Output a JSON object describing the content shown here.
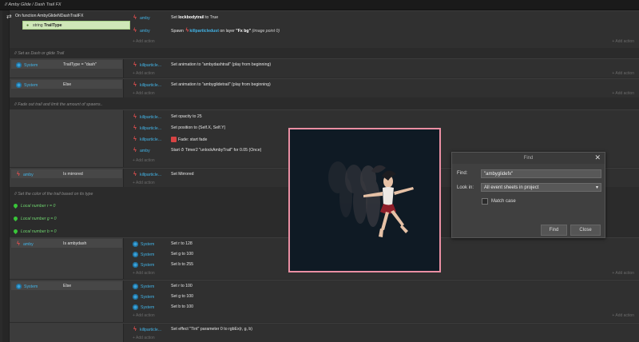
{
  "breadcrumb": "//  Amby Glide / Dash Trail FX",
  "function_block": {
    "header": "On function AmbyGlideNDashTrailFX",
    "param_type": "string",
    "param_name": "TrailType",
    "actions": [
      {
        "object": "amby",
        "text_pre": "Set ",
        "bold": "lockbodytrail",
        "text_post": " to True"
      },
      {
        "object": "amby",
        "text_pre": "Spawn ",
        "bold": "killparticledust",
        "text_post": " on layer ",
        "bold2": "\"Fx bg\"",
        "text_post2": " (image point 0)"
      }
    ]
  },
  "add_action": "+ Add action",
  "comments": [
    "//  Set as Dash or glide Trail",
    "//  Fade out trail and limit the amount of spawns..",
    "//  Set the color of the trail based on its type"
  ],
  "events": [
    {
      "cond_obj": "System",
      "cond_text": "TrailType = \"dash\"",
      "action": {
        "object": "killparticle...",
        "text": "Set animation to \"ambydashtrail\" (play from beginning)"
      }
    },
    {
      "cond_obj": "System",
      "cond_text": "Else",
      "action": {
        "object": "killparticle...",
        "text": "Set animation to \"ambyglidetrail\" (play from beginning)"
      }
    }
  ],
  "fade_actions": [
    {
      "object": "killparticle...",
      "text": "Set opacity to 25"
    },
    {
      "object": "killparticle...",
      "text": "Set position to (Self.X, Self.Y)"
    },
    {
      "object": "killparticle...",
      "text": "Fade: start fade"
    },
    {
      "object": "amby",
      "text": "Start ⏱ Timer2 \"unlockAmbyTrail\" for 0.05 (Once)"
    }
  ],
  "mirrored_event": {
    "cond_obj": "amby",
    "cond_text": "Is mirrored",
    "action": {
      "object": "killparticle...",
      "text": "Set Mirrored"
    }
  },
  "local_vars": [
    "Local number r = 0",
    "Local number g = 0",
    "Local number b = 0"
  ],
  "dash_event": {
    "cond_obj": "amby",
    "cond_text": "Is ambydash",
    "actions": [
      {
        "object": "System",
        "text": "Set r to 128"
      },
      {
        "object": "System",
        "text": "Set g to 100"
      },
      {
        "object": "System",
        "text": "Set b to 255"
      }
    ]
  },
  "else_event": {
    "cond_obj": "System",
    "cond_text": "Else",
    "actions": [
      {
        "object": "System",
        "text": "Set r to 100"
      },
      {
        "object": "System",
        "text": "Set g to 100"
      },
      {
        "object": "System",
        "text": "Set b to 100"
      }
    ]
  },
  "effect_action": {
    "object": "killparticle...",
    "text": "Set effect \"Tint\" parameter 0 to rgbEx(r, g, b)"
  },
  "find_dialog": {
    "title": "Find",
    "find_label": "Find:",
    "find_value": "\"ambyglidefx\"",
    "lookin_label": "Look in:",
    "lookin_value": "All event sheets in project",
    "match_case": "Match case",
    "find_btn": "Find",
    "close_btn": "Close"
  },
  "colors": {
    "accent": "#42b3e6",
    "preview_border": "#ea8fa3",
    "local_var": "#6ed36e"
  }
}
